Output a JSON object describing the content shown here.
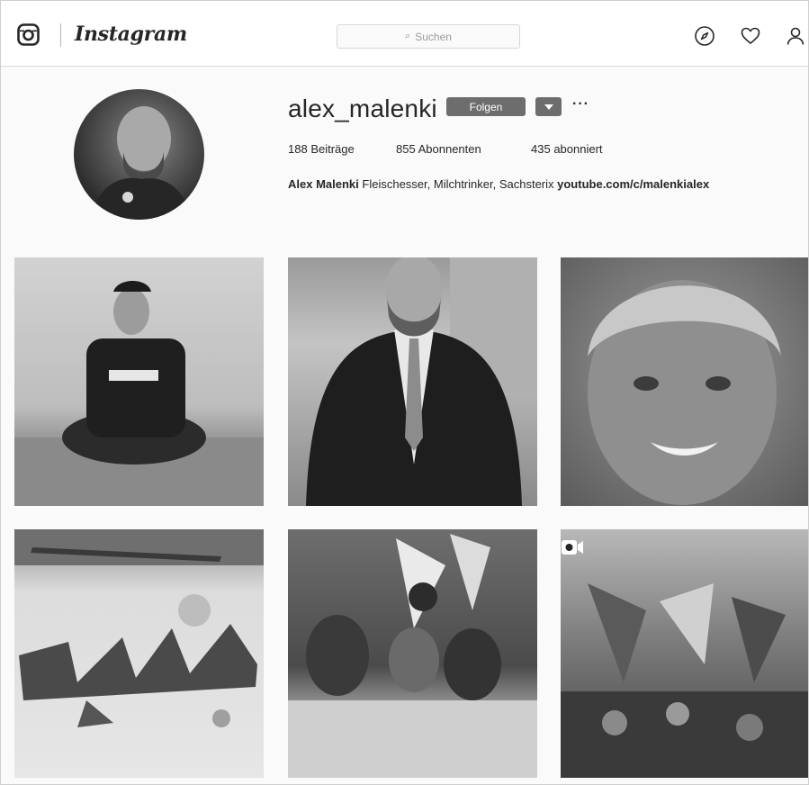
{
  "header": {
    "wordmark": "Instagram",
    "search_placeholder": "Suchen",
    "icons": [
      "instagram-logo-icon",
      "search-icon",
      "compass-icon",
      "heart-icon",
      "person-icon"
    ]
  },
  "profile": {
    "username": "alex_malenki",
    "follow_label": "Folgen",
    "more_label": "···",
    "stats": {
      "posts_count": "188",
      "posts_label": "Beiträge",
      "followers_count": "855",
      "followers_label": "Abonnenten",
      "following_count": "435",
      "following_label": "abonniert"
    },
    "bio": {
      "name": "Alex Malenki",
      "text": "Fleischesser, Milchtrinker, Sachsterix",
      "link": "youtube.com/c/malenkialex"
    }
  },
  "grid": {
    "tiles": [
      {
        "index": 1,
        "type": "photo"
      },
      {
        "index": 2,
        "type": "photo"
      },
      {
        "index": 3,
        "type": "photo"
      },
      {
        "index": 4,
        "type": "photo"
      },
      {
        "index": 5,
        "type": "photo"
      },
      {
        "index": 6,
        "type": "video",
        "badge_icon": "video-camera-icon"
      }
    ]
  },
  "colors": {
    "button_bg": "#6d6d6d",
    "text": "#262626",
    "border": "#dbdbdb",
    "background": "#fafafa"
  }
}
